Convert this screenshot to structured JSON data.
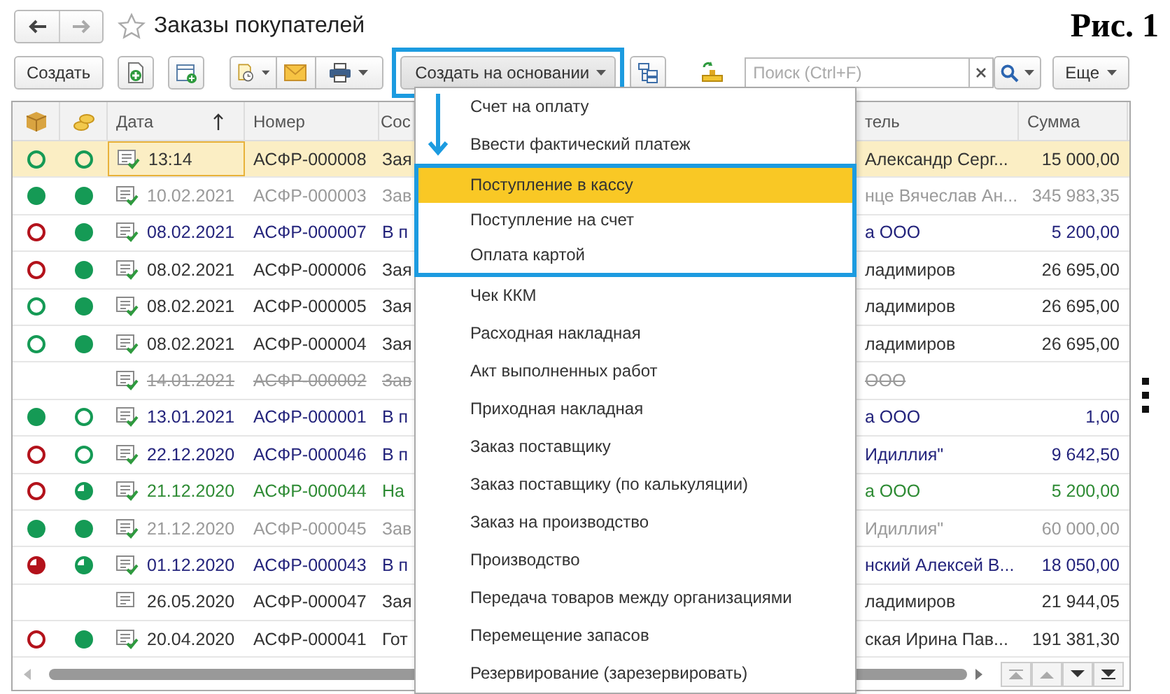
{
  "window": {
    "title": "Заказы покупателей",
    "figure_label": "Рис. 1"
  },
  "toolbar": {
    "create_label": "Создать",
    "create_based_label": "Создать на основании",
    "create_based_highlighted": true,
    "search": {
      "placeholder": "Поиск (Ctrl+F)"
    },
    "more_label": "Еще"
  },
  "table": {
    "columns": [
      {
        "kind": "icon-box"
      },
      {
        "kind": "icon-coins"
      },
      {
        "kind": "date",
        "label": "Дата",
        "sorted": true
      },
      {
        "kind": "number",
        "label": "Номер"
      },
      {
        "kind": "status",
        "label": "Сос"
      },
      {
        "kind": "counterparty",
        "label": "тель"
      },
      {
        "kind": "sum",
        "label": "Сумма"
      }
    ],
    "rows": [
      {
        "status_1": {
          "kind": "empty",
          "color": "#159a55"
        },
        "status_2": {
          "kind": "empty",
          "color": "#159a55"
        },
        "posted": true,
        "date": "13:14",
        "number": "АСФР-000008",
        "state": "Зая",
        "counterparty": "Александр Серг...",
        "sum": "15 000,00",
        "color": "#333333",
        "strike": false,
        "selected": true,
        "focused": true
      },
      {
        "status_1": {
          "kind": "full",
          "color": "#159a55"
        },
        "status_2": {
          "kind": "full",
          "color": "#159a55"
        },
        "posted": true,
        "date": "10.02.2021",
        "number": "АСФР-000003",
        "state": "Зав",
        "counterparty": "нце Вячеслав Ан...",
        "sum": "345 983,35",
        "color": "#9a9a9a",
        "strike": false,
        "selected": false,
        "focused": false
      },
      {
        "status_1": {
          "kind": "empty",
          "color": "#b3121b"
        },
        "status_2": {
          "kind": "full",
          "color": "#159a55"
        },
        "posted": true,
        "date": "08.02.2021",
        "number": "АСФР-000007",
        "state": "В п",
        "counterparty": "а ООО",
        "sum": "5 200,00",
        "color": "#24247c",
        "strike": false,
        "selected": false,
        "focused": false
      },
      {
        "status_1": {
          "kind": "empty",
          "color": "#b3121b"
        },
        "status_2": {
          "kind": "full",
          "color": "#159a55"
        },
        "posted": true,
        "date": "08.02.2021",
        "number": "АСФР-000006",
        "state": "Зая",
        "counterparty": "ладимиров",
        "sum": "26 695,00",
        "color": "#333333",
        "strike": false,
        "selected": false,
        "focused": false
      },
      {
        "status_1": {
          "kind": "empty",
          "color": "#159a55"
        },
        "status_2": {
          "kind": "full",
          "color": "#159a55"
        },
        "posted": true,
        "date": "08.02.2021",
        "number": "АСФР-000005",
        "state": "Зая",
        "counterparty": "ладимиров",
        "sum": "26 695,00",
        "color": "#333333",
        "strike": false,
        "selected": false,
        "focused": false
      },
      {
        "status_1": {
          "kind": "empty",
          "color": "#159a55"
        },
        "status_2": {
          "kind": "full",
          "color": "#159a55"
        },
        "posted": true,
        "date": "08.02.2021",
        "number": "АСФР-000004",
        "state": "Зая",
        "counterparty": "ладимиров",
        "sum": "26 695,00",
        "color": "#333333",
        "strike": false,
        "selected": false,
        "focused": false
      },
      {
        "posted": true,
        "date": "14.01.2021",
        "number": "АСФР-000002",
        "state": "Зав",
        "counterparty": "ООО",
        "color": "#9a9a9a",
        "strike": true,
        "selected": false,
        "focused": false
      },
      {
        "status_1": {
          "kind": "full",
          "color": "#159a55"
        },
        "status_2": {
          "kind": "empty",
          "color": "#159a55"
        },
        "posted": true,
        "date": "13.01.2021",
        "number": "АСФР-000001",
        "state": "В п",
        "counterparty": "а ООО",
        "sum": "1,00",
        "color": "#24247c",
        "strike": false,
        "selected": false,
        "focused": false
      },
      {
        "status_1": {
          "kind": "empty",
          "color": "#b3121b"
        },
        "status_2": {
          "kind": "empty",
          "color": "#159a55"
        },
        "posted": true,
        "date": "22.12.2020",
        "number": "АСФР-000046",
        "state": "В п",
        "counterparty": "Идиллия\"",
        "sum": "9 642,50",
        "color": "#24247c",
        "strike": false,
        "selected": false,
        "focused": false
      },
      {
        "status_1": {
          "kind": "empty",
          "color": "#b3121b"
        },
        "status_2": {
          "kind": "half",
          "color": "#159a55"
        },
        "posted": true,
        "date": "21.12.2020",
        "number": "АСФР-000044",
        "state": "На",
        "counterparty": "а ООО",
        "sum": "5 200,00",
        "color": "#2e8b34",
        "strike": false,
        "selected": false,
        "focused": false
      },
      {
        "status_1": {
          "kind": "full",
          "color": "#159a55"
        },
        "status_2": {
          "kind": "full",
          "color": "#159a55"
        },
        "posted": true,
        "date": "21.12.2020",
        "number": "АСФР-000045",
        "state": "Зав",
        "counterparty": "Идиллия\"",
        "sum": "60 000,00",
        "color": "#9a9a9a",
        "strike": false,
        "selected": false,
        "focused": false
      },
      {
        "status_1": {
          "kind": "half",
          "color": "#b3121b"
        },
        "status_2": {
          "kind": "half",
          "color": "#159a55"
        },
        "posted": true,
        "date": "01.12.2020",
        "number": "АСФР-000043",
        "state": "В п",
        "counterparty": "нский Алексей В...",
        "sum": "18 050,00",
        "color": "#24247c",
        "strike": false,
        "selected": false,
        "focused": false
      },
      {
        "posted": false,
        "date": "26.05.2020",
        "number": "АСФР-000047",
        "state": "Зая",
        "counterparty": "ладимиров",
        "sum": "21 944,05",
        "color": "#333333",
        "strike": false,
        "selected": false,
        "focused": false
      },
      {
        "status_1": {
          "kind": "empty",
          "color": "#b3121b"
        },
        "status_2": {
          "kind": "full",
          "color": "#159a55"
        },
        "posted": true,
        "date": "20.04.2020",
        "number": "АСФР-000041",
        "state": "Гот",
        "counterparty": "ская Ирина Пав...",
        "sum": "191 381,30",
        "color": "#333333",
        "strike": false,
        "selected": false,
        "focused": false
      }
    ]
  },
  "menu": {
    "items": [
      {
        "label": "Счет на оплату",
        "selected": false,
        "framed": false
      },
      {
        "label": "Ввести фактический платеж",
        "selected": false,
        "framed": false
      },
      {
        "label": "Поступление в кассу",
        "selected": true,
        "framed": true
      },
      {
        "label": "Поступление на счет",
        "selected": false,
        "framed": true
      },
      {
        "label": "Оплата картой",
        "selected": false,
        "framed": true
      },
      {
        "label": "Чек ККМ",
        "selected": false,
        "framed": false
      },
      {
        "label": "Расходная накладная",
        "selected": false,
        "framed": false
      },
      {
        "label": "Акт выполненных работ",
        "selected": false,
        "framed": false
      },
      {
        "label": "Приходная накладная",
        "selected": false,
        "framed": false
      },
      {
        "label": "Заказ поставщику",
        "selected": false,
        "framed": false
      },
      {
        "label": "Заказ поставщику (по калькуляции)",
        "selected": false,
        "framed": false
      },
      {
        "label": "Заказ на производство",
        "selected": false,
        "framed": false
      },
      {
        "label": "Производство",
        "selected": false,
        "framed": false
      },
      {
        "label": "Передача товаров между организациями",
        "selected": false,
        "framed": false
      },
      {
        "label": "Перемещение запасов",
        "selected": false,
        "framed": false
      },
      {
        "label": "Резервирование (зарезервировать)",
        "selected": false,
        "framed": false
      }
    ]
  }
}
